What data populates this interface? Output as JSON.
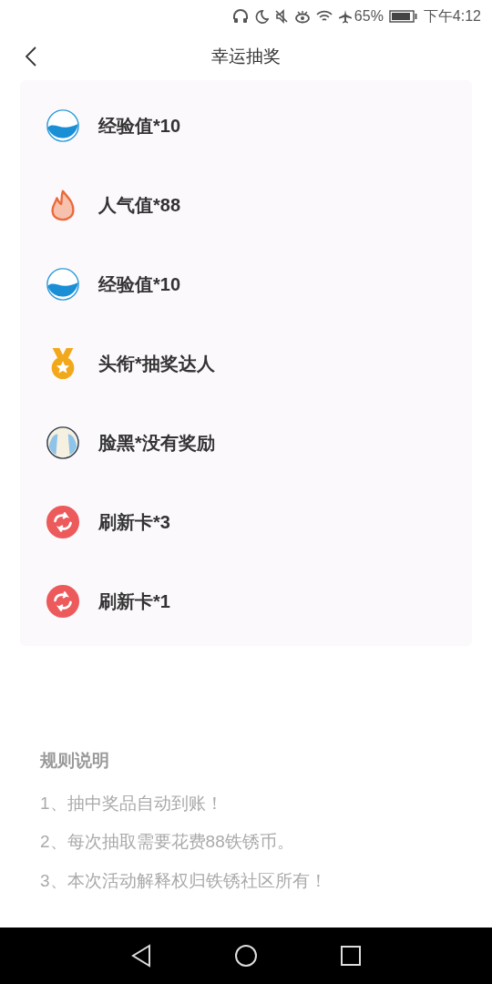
{
  "status_bar": {
    "battery": "65%",
    "time": "下午4:12"
  },
  "header": {
    "title": "幸运抽奖"
  },
  "prizes": [
    {
      "kind": "exp",
      "label": "经验值*10"
    },
    {
      "kind": "fire",
      "label": "人气值*88"
    },
    {
      "kind": "exp",
      "label": "经验值*10"
    },
    {
      "kind": "medal",
      "label": "头衔*抽奖达人"
    },
    {
      "kind": "face",
      "label": "脸黑*没有奖励"
    },
    {
      "kind": "refresh",
      "label": "刷新卡*3"
    },
    {
      "kind": "refresh",
      "label": "刷新卡*1"
    }
  ],
  "rules": {
    "title": "规则说明",
    "items": [
      "1、抽中奖品自动到账！",
      "2、每次抽取需要花费88铁锈币。",
      "3、本次活动解释权归铁锈社区所有！"
    ]
  }
}
